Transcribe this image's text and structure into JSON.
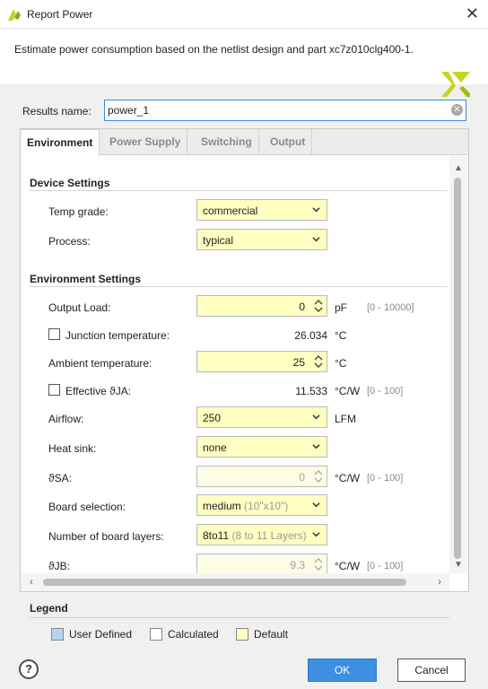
{
  "window": {
    "title": "Report Power"
  },
  "header": {
    "description": "Estimate power consumption based on the netlist design and part xc7z010clg400-1."
  },
  "results": {
    "label": "Results name:",
    "value": "power_1"
  },
  "tabs": [
    {
      "label": "Environment"
    },
    {
      "label": "Power Supply"
    },
    {
      "label": "Switching"
    },
    {
      "label": "Output"
    }
  ],
  "device_settings": {
    "heading": "Device Settings",
    "temp_grade": {
      "label": "Temp grade:",
      "value": "commercial"
    },
    "process": {
      "label": "Process:",
      "value": "typical"
    }
  },
  "environment_settings": {
    "heading": "Environment Settings",
    "output_load": {
      "label": "Output Load:",
      "value": "0",
      "unit": "pF",
      "range": "[0 - 10000]"
    },
    "junction_temperature": {
      "label": "Junction temperature:",
      "value": "26.034",
      "unit": "°C"
    },
    "ambient_temperature": {
      "label": "Ambient temperature:",
      "value": "25",
      "unit": "°C"
    },
    "effective_theta_ja": {
      "label": "Effective ϑJA:",
      "value": "11.533",
      "unit": "°C/W",
      "range": "[0 - 100]"
    },
    "airflow": {
      "label": "Airflow:",
      "value": "250",
      "unit": "LFM"
    },
    "heat_sink": {
      "label": "Heat sink:",
      "value": "none"
    },
    "theta_sa": {
      "label": "ϑSA:",
      "value": "0",
      "unit": "°C/W",
      "range": "[0 - 100]"
    },
    "board_selection": {
      "label": "Board selection:",
      "value": "medium",
      "hint": "(10\"x10\")"
    },
    "board_layers": {
      "label": "Number of board layers:",
      "value": "8to11",
      "hint": "(8 to 11 Layers)"
    },
    "theta_jb": {
      "label": "ϑJB:",
      "value": "9.3",
      "unit": "°C/W",
      "range": "[0 - 100]"
    }
  },
  "legend": {
    "title": "Legend",
    "items": [
      {
        "label": "User Defined",
        "color": "#b8d4f0"
      },
      {
        "label": "Calculated",
        "color": "#ffffff"
      },
      {
        "label": "Default",
        "color": "#ffffc2"
      }
    ]
  },
  "buttons": {
    "help": "?",
    "ok": "OK",
    "cancel": "Cancel"
  },
  "colors": {
    "accent": "#3d8fe0",
    "default_field": "#ffffc2",
    "logo": "#c9d21e"
  }
}
